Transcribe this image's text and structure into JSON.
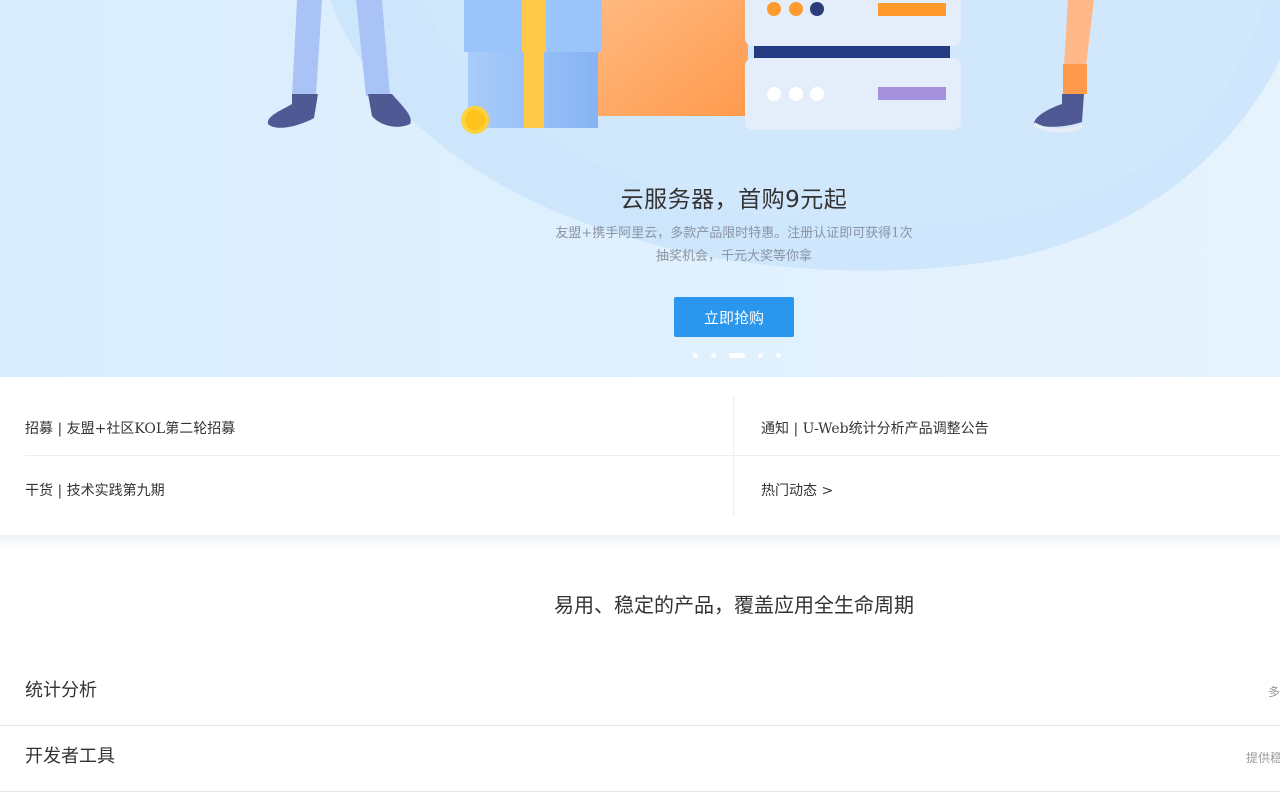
{
  "hero": {
    "title": "云服务器，首购9元起",
    "subtitle_line1": "友盟+携手阿里云，多款产品限时特惠。注册认证即可获得1次",
    "subtitle_line2": "抽奖机会，千元大奖等你拿",
    "button_label": "立即抢购",
    "carousel": {
      "total": 5,
      "active_index": 2
    },
    "colors": {
      "background": "#dcefff",
      "button": "#2a96ee"
    }
  },
  "news": {
    "items": [
      {
        "text": "招募 | 友盟+社区KOL第二轮招募"
      },
      {
        "text": "通知 | U-Web统计分析产品调整公告"
      },
      {
        "text": "干货 | 技术实践第九期"
      },
      {
        "text": "热门动态 >"
      }
    ]
  },
  "products": {
    "section_title": "易用、稳定的产品，覆盖应用全生命周期",
    "rows": [
      {
        "name": "统计分析",
        "desc": "多"
      },
      {
        "name": "开发者工具",
        "desc": "提供稳"
      }
    ]
  }
}
